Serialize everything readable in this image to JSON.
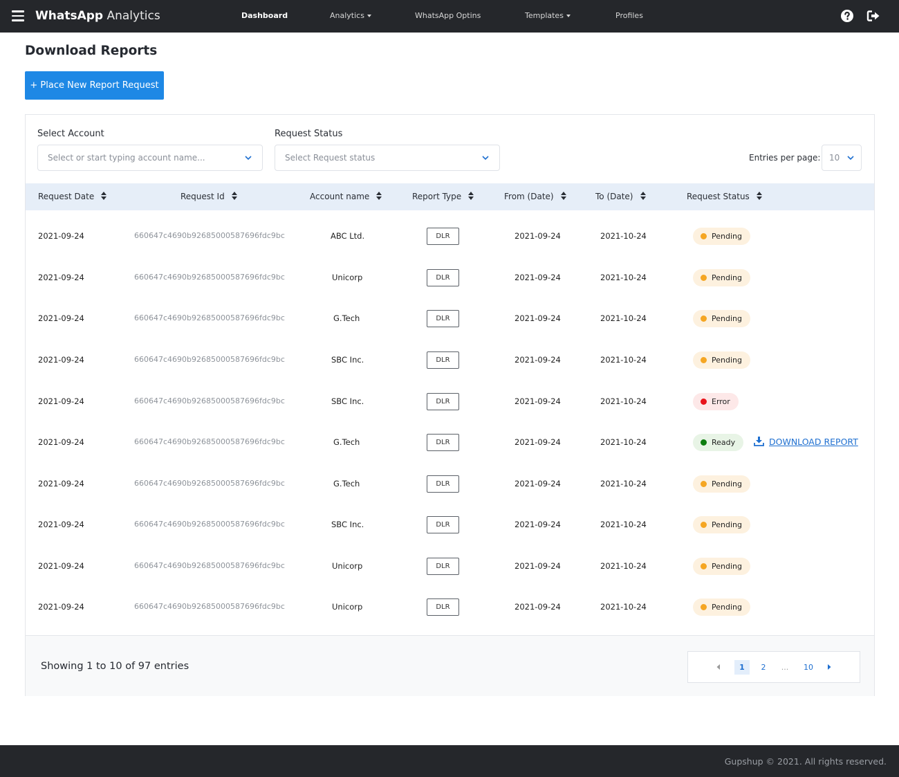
{
  "app": {
    "title_bold": "WhatsApp",
    "title_light": " Analytics"
  },
  "nav": {
    "items": [
      {
        "label": "Dashboard"
      },
      {
        "label": "Analytics"
      },
      {
        "label": "WhatsApp Optins"
      },
      {
        "label": "Templates"
      },
      {
        "label": "Profiles"
      }
    ],
    "icons": [
      "help-icon",
      "logout-icon"
    ]
  },
  "page": {
    "title": "Download Reports",
    "new_request_button": "+ Place New Report Request"
  },
  "filters": {
    "account": {
      "label": "Select Account",
      "placeholder": "Select or start typing account name..."
    },
    "status": {
      "label": "Request Status",
      "placeholder": "Select Request status"
    },
    "entries_label": "Entries per page:",
    "entries_value": "10"
  },
  "table": {
    "columns": [
      "Request Date",
      "Request Id",
      "Account name",
      "Report Type",
      "From (Date)",
      "To (Date)",
      "Request Status"
    ],
    "rows": [
      {
        "date": "2021-09-24",
        "id": "660647c4690b92685000587696fdc9bc",
        "account": "ABC Ltd.",
        "type": "DLR",
        "from": "2021-09-24",
        "to": "2021-10-24",
        "status": "Pending"
      },
      {
        "date": "2021-09-24",
        "id": "660647c4690b92685000587696fdc9bc",
        "account": "Unicorp",
        "type": "DLR",
        "from": "2021-09-24",
        "to": "2021-10-24",
        "status": "Pending"
      },
      {
        "date": "2021-09-24",
        "id": "660647c4690b92685000587696fdc9bc",
        "account": "G.Tech",
        "type": "DLR",
        "from": "2021-09-24",
        "to": "2021-10-24",
        "status": "Pending"
      },
      {
        "date": "2021-09-24",
        "id": "660647c4690b92685000587696fdc9bc",
        "account": "SBC Inc.",
        "type": "DLR",
        "from": "2021-09-24",
        "to": "2021-10-24",
        "status": "Pending"
      },
      {
        "date": "2021-09-24",
        "id": "660647c4690b92685000587696fdc9bc",
        "account": "SBC Inc.",
        "type": "DLR",
        "from": "2021-09-24",
        "to": "2021-10-24",
        "status": "Error"
      },
      {
        "date": "2021-09-24",
        "id": "660647c4690b92685000587696fdc9bc",
        "account": "G.Tech",
        "type": "DLR",
        "from": "2021-09-24",
        "to": "2021-10-24",
        "status": "Ready",
        "action": "DOWNLOAD REPORT"
      },
      {
        "date": "2021-09-24",
        "id": "660647c4690b92685000587696fdc9bc",
        "account": "G.Tech",
        "type": "DLR",
        "from": "2021-09-24",
        "to": "2021-10-24",
        "status": "Pending"
      },
      {
        "date": "2021-09-24",
        "id": "660647c4690b92685000587696fdc9bc",
        "account": "SBC Inc.",
        "type": "DLR",
        "from": "2021-09-24",
        "to": "2021-10-24",
        "status": "Pending"
      },
      {
        "date": "2021-09-24",
        "id": "660647c4690b92685000587696fdc9bc",
        "account": "Unicorp",
        "type": "DLR",
        "from": "2021-09-24",
        "to": "2021-10-24",
        "status": "Pending"
      },
      {
        "date": "2021-09-24",
        "id": "660647c4690b92685000587696fdc9bc",
        "account": "Unicorp",
        "type": "DLR",
        "from": "2021-09-24",
        "to": "2021-10-24",
        "status": "Pending"
      }
    ]
  },
  "status_colors": {
    "Pending": "#f5a623",
    "Error": "#e8141b",
    "Ready": "#0e7d10"
  },
  "pagination": {
    "summary": "Showing 1 to 10 of 97 entries",
    "pages": [
      "1",
      "2",
      "...",
      "10"
    ],
    "current": "1"
  },
  "footer": {
    "copyright": "Gupshup © 2021. All rights reserved."
  },
  "colors": {
    "topbar": "#25272b",
    "accent": "#1e88e5",
    "table_header": "#e6eef8"
  }
}
